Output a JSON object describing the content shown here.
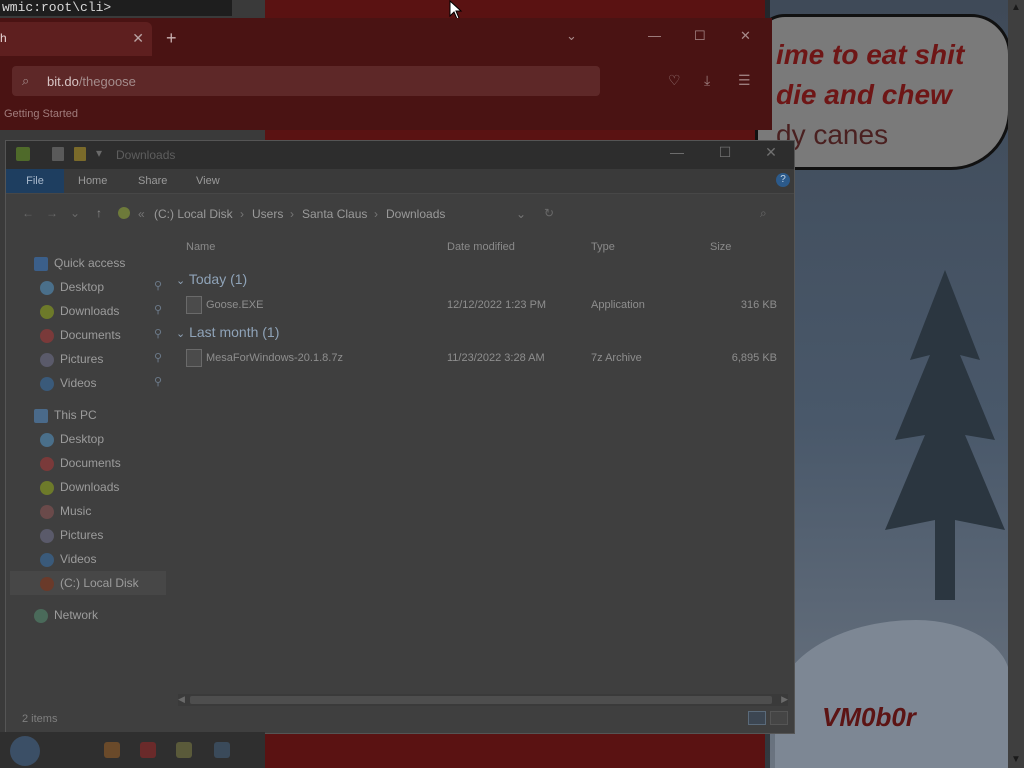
{
  "terminal": {
    "text": "wmic:root\\cli>"
  },
  "speech": {
    "lines": [
      "ime to eat shit",
      "die and chew",
      "dy canes"
    ]
  },
  "wallpaper": {
    "tag": "VM0b0r"
  },
  "browser": {
    "tab_label": "h",
    "url_host": "bit.do",
    "url_path": "/thegoose",
    "bookmark": "Getting Started",
    "colors": {
      "frame": "#4a1313",
      "urlbar": "#5e2828"
    }
  },
  "explorer": {
    "title": "Downloads",
    "ribbon_tabs": [
      "File",
      "Home",
      "Share",
      "View"
    ],
    "breadcrumb": [
      "(C:) Local Disk",
      "Users",
      "Santa Claus",
      "Downloads"
    ],
    "breadcrumb_overflow": "«",
    "columns": [
      "Name",
      "Date modified",
      "Type",
      "Size"
    ],
    "groups": [
      {
        "label": "Today (1)",
        "files": [
          {
            "name": "Goose.EXE",
            "date": "12/12/2022 1:23 PM",
            "type": "Application",
            "size": "316 KB"
          }
        ]
      },
      {
        "label": "Last month (1)",
        "files": [
          {
            "name": "MesaForWindows-20.1.8.7z",
            "date": "11/23/2022 3:28 AM",
            "type": "7z Archive",
            "size": "6,895 KB"
          }
        ]
      }
    ],
    "quick_access": {
      "label": "Quick access",
      "items": [
        "Desktop",
        "Downloads",
        "Documents",
        "Pictures",
        "Videos"
      ]
    },
    "this_pc": {
      "label": "This PC",
      "items": [
        "Desktop",
        "Documents",
        "Downloads",
        "Music",
        "Pictures",
        "Videos",
        "(C:) Local Disk"
      ]
    },
    "network": "Network",
    "status": "2 items",
    "colors": {
      "file_tab": "#1e3e60",
      "group_text": "#8fa3b8"
    }
  }
}
